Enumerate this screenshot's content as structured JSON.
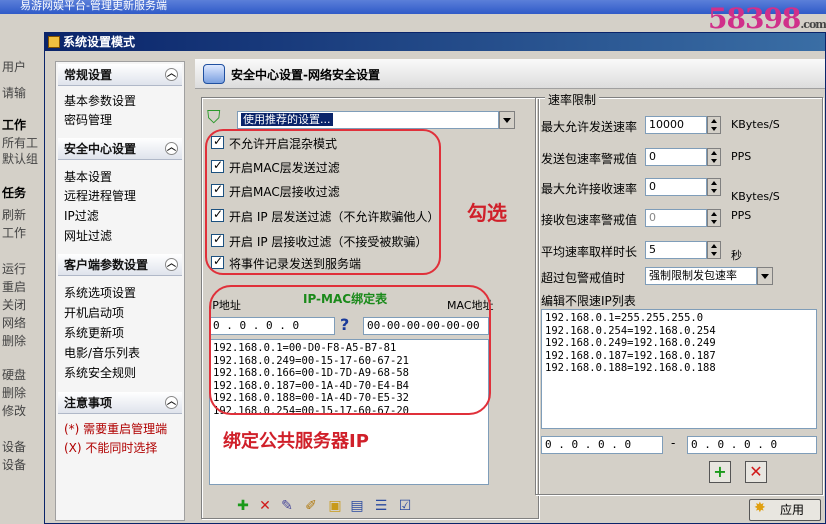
{
  "bg": {
    "title": "易游网娱平台-管理更新服务端",
    "left_label": "用户",
    "items": [
      "请输",
      "工作",
      "所有工",
      "默认组",
      "任务",
      "刷新",
      "工作",
      "运行",
      "重启",
      "关闭",
      "网络",
      "删除",
      "硬盘",
      "删除",
      "修改",
      "设备",
      "设备"
    ]
  },
  "watermark": {
    "main": "58398",
    "suffix": ".com"
  },
  "dialog": {
    "title": "系统设置模式"
  },
  "nav": {
    "sections": [
      {
        "title": "常规设置",
        "items": [
          "基本参数设置",
          "密码管理"
        ]
      },
      {
        "title": "安全中心设置",
        "items": [
          "基本设置",
          "远程进程管理",
          "IP过滤",
          "网址过滤"
        ]
      },
      {
        "title": "客户端参数设置",
        "items": [
          "系统选项设置",
          "开机启动项",
          "系统更新项",
          "电影/音乐列表",
          "系统安全规则"
        ]
      },
      {
        "title": "注意事项",
        "notes": [
          "(*) 需要重启管理端",
          "(X) 不能同时选择"
        ]
      }
    ]
  },
  "main": {
    "header_title": "安全中心设置-网络安全设置"
  },
  "security": {
    "preset_value": "使用推荐的设置...",
    "options": [
      {
        "label": "不允许开启混杂模式",
        "checked": true
      },
      {
        "label": "开启MAC层发送过滤",
        "checked": true
      },
      {
        "label": "开启MAC层接收过滤",
        "checked": true
      },
      {
        "label": "开启 IP 层发送过滤（不允许欺骗他人）",
        "checked": true
      },
      {
        "label": "开启 IP 层接收过滤（不接受被欺骗）",
        "checked": true
      },
      {
        "label": "将事件记录发送到服务端",
        "checked": true
      }
    ],
    "annotation_check": "勾选"
  },
  "ipmac": {
    "title": "IP-MAC绑定表",
    "ip_label": "IP地址",
    "mac_label": "MAC地址",
    "ip_input": "0 . 0 . 0 . 0",
    "help": "?",
    "mac_input": "00-00-00-00-00-00",
    "entries": [
      "192.168.0.1=00-D0-F8-A5-B7-81",
      "192.168.0.249=00-15-17-60-67-21",
      "192.168.0.166=00-1D-7D-A9-68-58",
      "192.168.0.187=00-1A-4D-70-E4-B4",
      "192.168.0.188=00-1A-4D-70-E5-32",
      "192.168.0.254=00-15-17-60-67-20"
    ],
    "annotation_bind": "绑定公共服务器IP"
  },
  "rate": {
    "legend": "速率限制",
    "rows": [
      {
        "label": "最大允许发送速率",
        "value": "10000",
        "unit": "KBytes/S"
      },
      {
        "label": "发送包速率警戒值",
        "value": "0",
        "unit": "PPS"
      },
      {
        "label": "最大允许接收速率",
        "value": "0",
        "unit": "KBytes/S"
      },
      {
        "label": "接收包速率警戒值",
        "value": "0",
        "unit": "PPS"
      },
      {
        "label": "平均速率取样时长",
        "value": "5",
        "unit": "秒"
      }
    ],
    "exceed_label": "超过包警戒值时",
    "exceed_value": "强制限制发包速率",
    "unlimited_label": "编辑不限速IP列表",
    "unlimited_list": [
      "192.168.0.1=255.255.255.0",
      "192.168.0.254=192.168.0.254",
      "192.168.0.249=192.168.0.249",
      "192.168.0.187=192.168.0.187",
      "192.168.0.188=192.168.0.188"
    ],
    "range_start": "0 . 0 . 0 . 0",
    "range_end": "0 . 0 . 0 . 0",
    "range_dash": "-"
  },
  "buttons": {
    "apply": "应用",
    "add": "+",
    "remove": "✕"
  }
}
